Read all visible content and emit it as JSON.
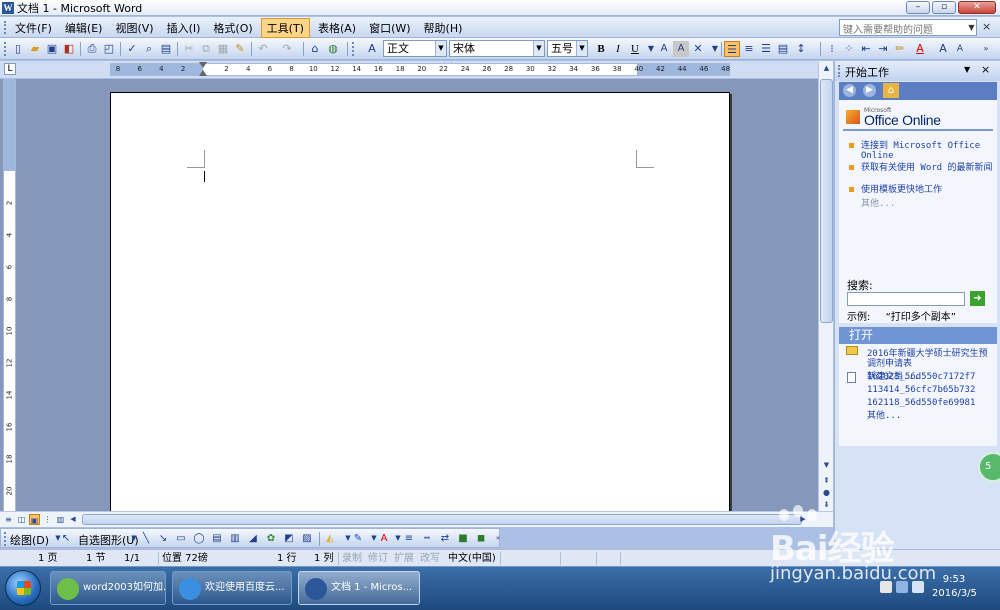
{
  "window": {
    "title": "文档 1 - Microsoft Word",
    "controls": {
      "minimize": "–",
      "maximize": "▫",
      "close": "✕"
    }
  },
  "menu": {
    "items": [
      "文件(F)",
      "编辑(E)",
      "视图(V)",
      "插入(I)",
      "格式(O)",
      "工具(T)",
      "表格(A)",
      "窗口(W)",
      "帮助(H)"
    ],
    "active_index": 5,
    "help_placeholder": "键入需要帮助的问题",
    "close_doc": "×"
  },
  "format_toolbar": {
    "style_value": "正文",
    "font_value": "宋体",
    "size_value": "五号",
    "bold": "B",
    "italic": "I",
    "underline": "U"
  },
  "ruler": {
    "numbers": [
      "8",
      "6",
      "4",
      "2",
      "2",
      "4",
      "6",
      "8",
      "10",
      "12",
      "14",
      "16",
      "18",
      "20",
      "22",
      "24",
      "26",
      "28",
      "30",
      "32",
      "34",
      "36",
      "38",
      "40",
      "42",
      "44",
      "46",
      "48"
    ],
    "vertical_numbers": [
      "2",
      "4",
      "6",
      "8",
      "10",
      "12",
      "14",
      "16",
      "18",
      "20"
    ]
  },
  "drawing_toolbar": {
    "draw_label": "绘图(D)",
    "autoshapes_label": "自选图形(U)"
  },
  "status_bar": {
    "page": "1 页",
    "section": "1 节",
    "page_of": "1/1",
    "position": "位置 72磅",
    "line": "1 行",
    "column": "1 列",
    "rec": "录制",
    "trk": "修订",
    "ext": "扩展",
    "ovr": "改写",
    "language": "中文(中国)"
  },
  "task_pane": {
    "title": "开始工作",
    "close": "×",
    "office_small": "Microsoft",
    "office_brand": "Office Online",
    "links": [
      "连接到 Microsoft Office Online",
      "获取有关使用 Word 的最新新闻",
      "使用模板更快地工作",
      "其他..."
    ],
    "search_label": "搜索:",
    "example_label": "示例:",
    "example_text": "“打印多个副本”",
    "open_title": "打开",
    "recent_files": [
      "2016年新疆大学硕士研究生预调剂申请表",
      "162023_56d550c7172f7",
      "113414_56cfc7b65b732",
      "162118_56d550fe69981"
    ],
    "more": "其他...",
    "new_doc": "新建文档..."
  },
  "taskbar": {
    "items": [
      {
        "label": "word2003如何加...",
        "active": false,
        "icon_color": "#6cc04a"
      },
      {
        "label": "欢迎使用百度云...",
        "active": false,
        "icon_color": "#3a8fe0"
      },
      {
        "label": "文档 1 - Micros...",
        "active": true,
        "icon_color": "#2b579a"
      }
    ],
    "time": "9:53",
    "date": "2016/3/5"
  },
  "watermark": {
    "brand": "Bai经验",
    "url": "jingyan.baidu.com",
    "side_badge": "5"
  },
  "colors": {
    "accent": "#2b579a",
    "active_menu": "#ffd58a",
    "bullet": "#f29b1a"
  }
}
